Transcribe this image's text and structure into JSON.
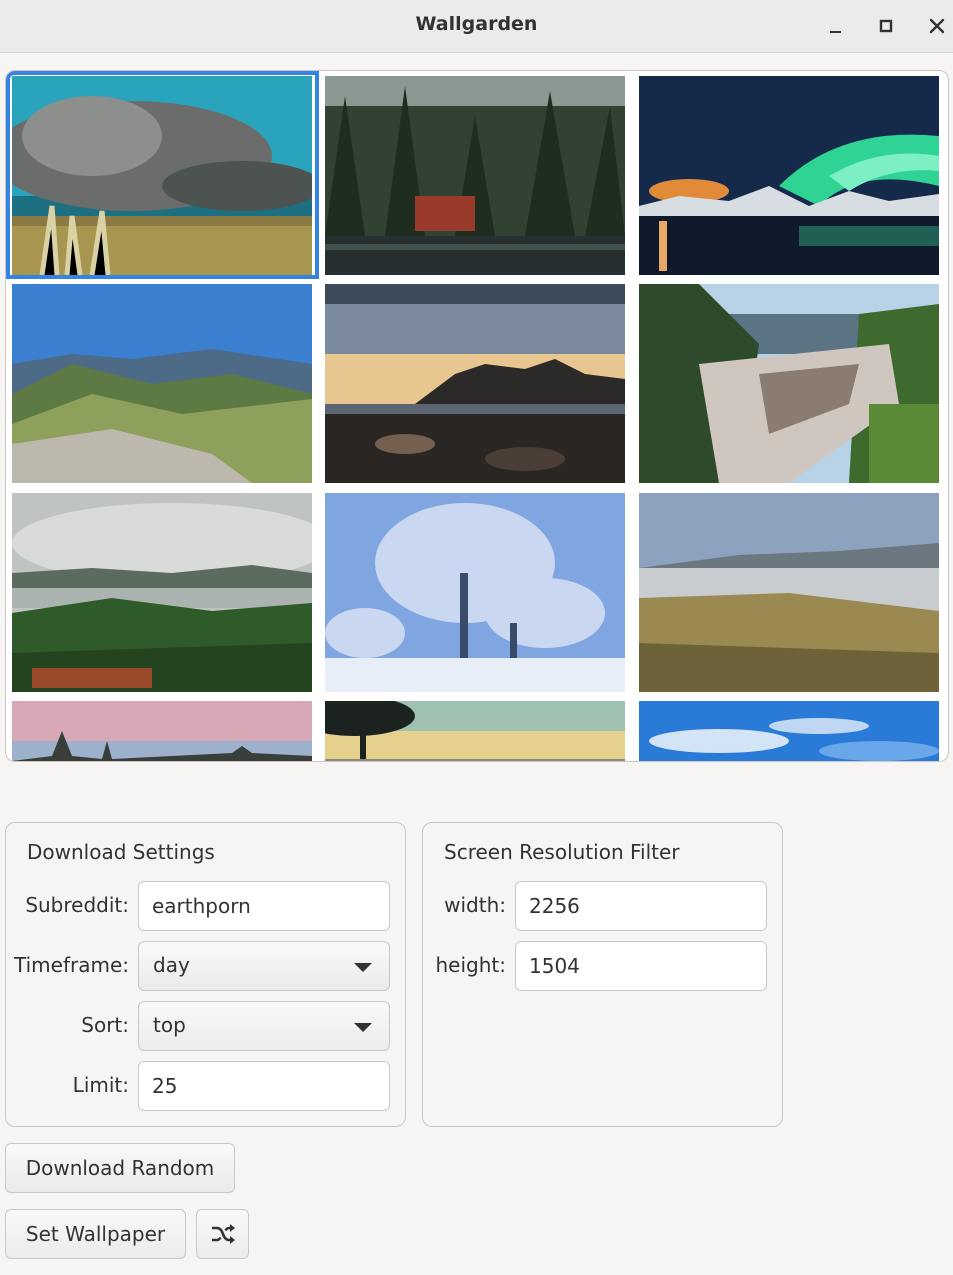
{
  "window": {
    "title": "Wallgarden",
    "controls": [
      "minimize-icon",
      "maximize-icon",
      "close-icon"
    ]
  },
  "gallery": {
    "selected_index": 0,
    "thumbnails": [
      {
        "subject": "storm clouds over grassland",
        "palette": [
          "#1d6f82",
          "#2fb4c9",
          "#5b5a56",
          "#a59a5c"
        ]
      },
      {
        "subject": "forest reflected in lake",
        "palette": [
          "#7d8c86",
          "#2c3a2c",
          "#9a3a2a",
          "#1c2424"
        ]
      },
      {
        "subject": "aurora over mountain lake",
        "palette": [
          "#15294a",
          "#2fd394",
          "#e08a3a",
          "#0e1a2c"
        ]
      },
      {
        "subject": "green mountain ridges under blue sky",
        "palette": [
          "#3a7fd0",
          "#5e7a44",
          "#8da05c",
          "#bdb8ae"
        ]
      },
      {
        "subject": "rocky coast at sunset",
        "palette": [
          "#3d4a5a",
          "#e7c78f",
          "#2c2a28",
          "#756050"
        ]
      },
      {
        "subject": "river rapids in forest",
        "palette": [
          "#b7d2e6",
          "#2e4a2a",
          "#cfc7bf",
          "#5a8a36"
        ]
      },
      {
        "subject": "misty green hills",
        "palette": [
          "#bfc4c2",
          "#5b6b60",
          "#2f5a2a",
          "#9a4a2a"
        ]
      },
      {
        "subject": "frosted tree in snow",
        "palette": [
          "#7fa6e0",
          "#e8eef8",
          "#4a6496",
          "#c9d8f0"
        ]
      },
      {
        "subject": "foggy meadow hill",
        "palette": [
          "#8da2be",
          "#c9ccce",
          "#9a8a52",
          "#6d6238"
        ]
      },
      {
        "subject": "pink dusk over treeline",
        "palette": [
          "#d7a9b6",
          "#9db1cc",
          "#3a3e3a"
        ]
      },
      {
        "subject": "golden sky with tree silhouette",
        "palette": [
          "#9fc2b0",
          "#e6d08e",
          "#1c2220"
        ]
      },
      {
        "subject": "blue sky with wispy clouds",
        "palette": [
          "#2a7ad8",
          "#ffffff",
          "#6aa6ea"
        ]
      }
    ]
  },
  "download_settings": {
    "title": "Download Settings",
    "subreddit_label": "Subreddit:",
    "subreddit_value": "earthporn",
    "timeframe_label": "Timeframe:",
    "timeframe_value": "day",
    "sort_label": "Sort:",
    "sort_value": "top",
    "limit_label": "Limit:",
    "limit_value": "25"
  },
  "resolution_filter": {
    "title": "Screen Resolution Filter",
    "width_label": "width:",
    "width_value": "2256",
    "height_label": "height:",
    "height_value": "1504"
  },
  "actions": {
    "download_random_label": "Download Random",
    "set_wallpaper_label": "Set Wallpaper",
    "shuffle_icon": "shuffle-icon"
  }
}
